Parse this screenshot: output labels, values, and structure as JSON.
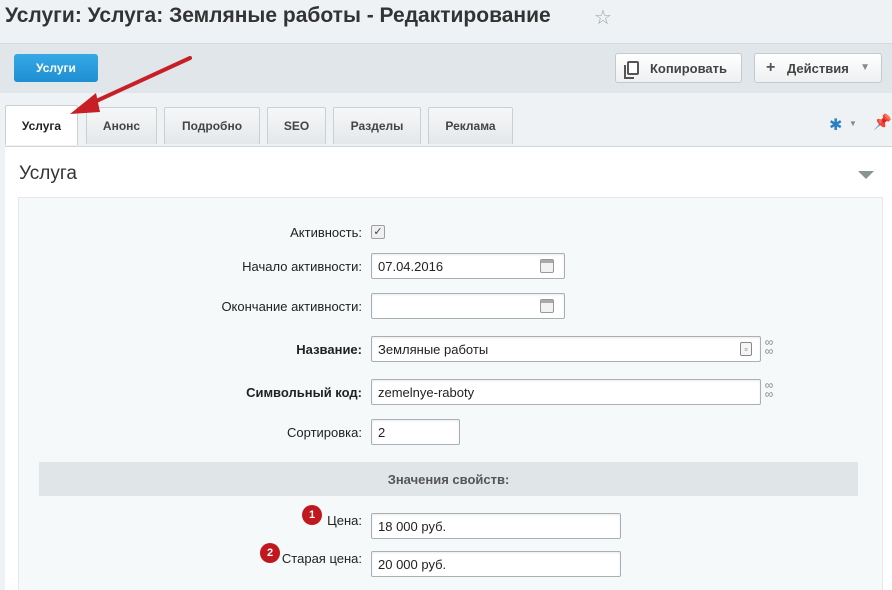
{
  "page": {
    "title": "Услуги: Услуга: Земляные работы - Редактирование"
  },
  "toolbar": {
    "back_label": "Услуги",
    "copy_label": "Копировать",
    "actions_label": "Действия"
  },
  "tabs": [
    {
      "label": "Услуга",
      "active": true
    },
    {
      "label": "Анонс",
      "active": false
    },
    {
      "label": "Подробно",
      "active": false
    },
    {
      "label": "SEO",
      "active": false
    },
    {
      "label": "Разделы",
      "active": false
    },
    {
      "label": "Реклама",
      "active": false
    }
  ],
  "section": {
    "title": "Услуга"
  },
  "form": {
    "active_label": "Активность:",
    "active_checked": true,
    "start_label": "Начало активности:",
    "start_value": "07.04.2016",
    "end_label": "Окончание активности:",
    "end_value": "",
    "name_label": "Название:",
    "name_value": "Земляные работы",
    "code_label": "Символьный код:",
    "code_value": "zemelnye-raboty",
    "sort_label": "Сортировка:",
    "sort_value": "2"
  },
  "properties": {
    "header": "Значения свойств:",
    "price_label": "Цена:",
    "price_value": "18 000 руб.",
    "price_badge": "1",
    "old_price_label": "Старая цена:",
    "old_price_value": "20 000 руб.",
    "old_price_badge": "2"
  },
  "colors": {
    "accent": "#1e8fd1",
    "badge": "#c0181f",
    "annotation_arrow": "#c62026"
  }
}
